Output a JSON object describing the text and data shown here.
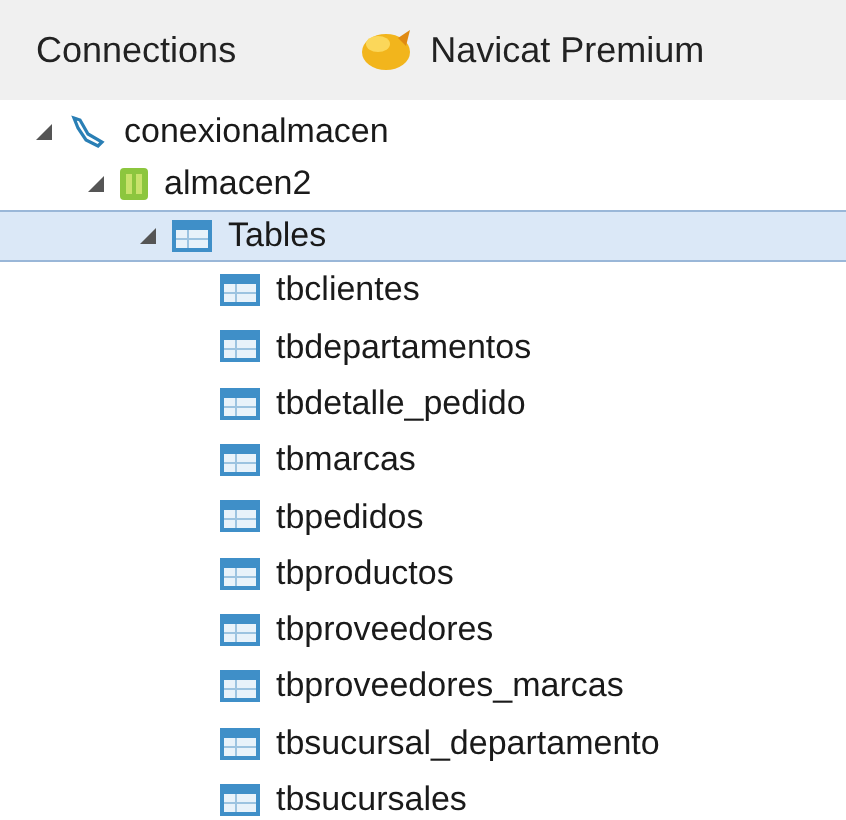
{
  "header": {
    "tabs": [
      {
        "label": "Connections",
        "kind": "plain"
      },
      {
        "label": "Navicat Premium",
        "kind": "app"
      }
    ]
  },
  "tree": [
    {
      "label": "conexionalmacen",
      "kind": "connection",
      "expanded": true,
      "selected": false,
      "children": [
        {
          "label": "almacen2",
          "kind": "database",
          "expanded": true,
          "selected": false,
          "children": [
            {
              "label": "Tables",
              "kind": "folder",
              "expanded": true,
              "selected": true,
              "children": [
                {
                  "label": "tbclientes",
                  "kind": "table",
                  "selected": false
                },
                {
                  "label": "tbdepartamentos",
                  "kind": "table",
                  "selected": false
                },
                {
                  "label": "tbdetalle_pedido",
                  "kind": "table",
                  "selected": false
                },
                {
                  "label": "tbmarcas",
                  "kind": "table",
                  "selected": false
                },
                {
                  "label": "tbpedidos",
                  "kind": "table",
                  "selected": false
                },
                {
                  "label": "tbproductos",
                  "kind": "table",
                  "selected": false
                },
                {
                  "label": "tbproveedores",
                  "kind": "table",
                  "selected": false
                },
                {
                  "label": "tbproveedores_marcas",
                  "kind": "table",
                  "selected": false
                },
                {
                  "label": "tbsucursal_departamento",
                  "kind": "table",
                  "selected": false
                },
                {
                  "label": "tbsucursales",
                  "kind": "table",
                  "selected": false
                }
              ]
            }
          ]
        }
      ]
    }
  ]
}
